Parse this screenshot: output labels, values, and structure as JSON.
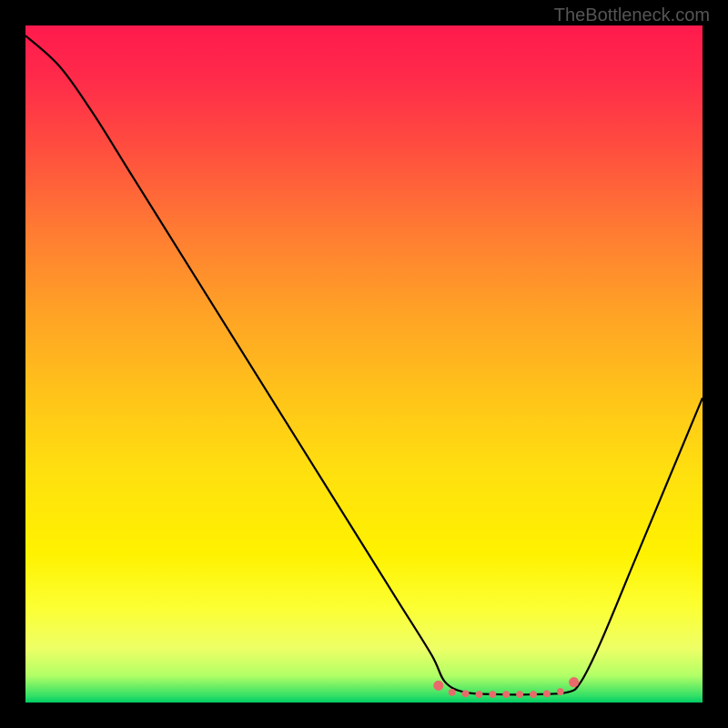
{
  "watermark": "TheBottleneck.com",
  "chart_data": {
    "type": "line",
    "title": "",
    "xlabel": "",
    "ylabel": "",
    "xlim": [
      0,
      100
    ],
    "ylim": [
      0,
      100
    ],
    "background_gradient": {
      "top": "#ff1a4d",
      "mid": "#ffe00f",
      "bottom": "#00cc66"
    },
    "series": [
      {
        "name": "bottleneck-curve",
        "color": "#000000",
        "x": [
          0,
          5,
          10,
          15,
          20,
          25,
          30,
          35,
          40,
          45,
          50,
          55,
          60,
          62,
          65,
          70,
          75,
          80,
          82,
          85,
          90,
          95,
          100
        ],
        "y": [
          98.5,
          94,
          87,
          79,
          71,
          63,
          55,
          47,
          39,
          31,
          23,
          15,
          7,
          3,
          1.5,
          1.2,
          1.2,
          1.5,
          3,
          9,
          21,
          33,
          45
        ]
      }
    ],
    "annotations": [
      {
        "name": "valley-markers",
        "type": "scatter",
        "color": "#e86b6b",
        "x": [
          61,
          63,
          65,
          67,
          69,
          71,
          73,
          75,
          77,
          79,
          81
        ],
        "y": [
          2.5,
          1.5,
          1.3,
          1.2,
          1.2,
          1.2,
          1.2,
          1.2,
          1.3,
          1.6,
          3.0
        ]
      }
    ]
  }
}
